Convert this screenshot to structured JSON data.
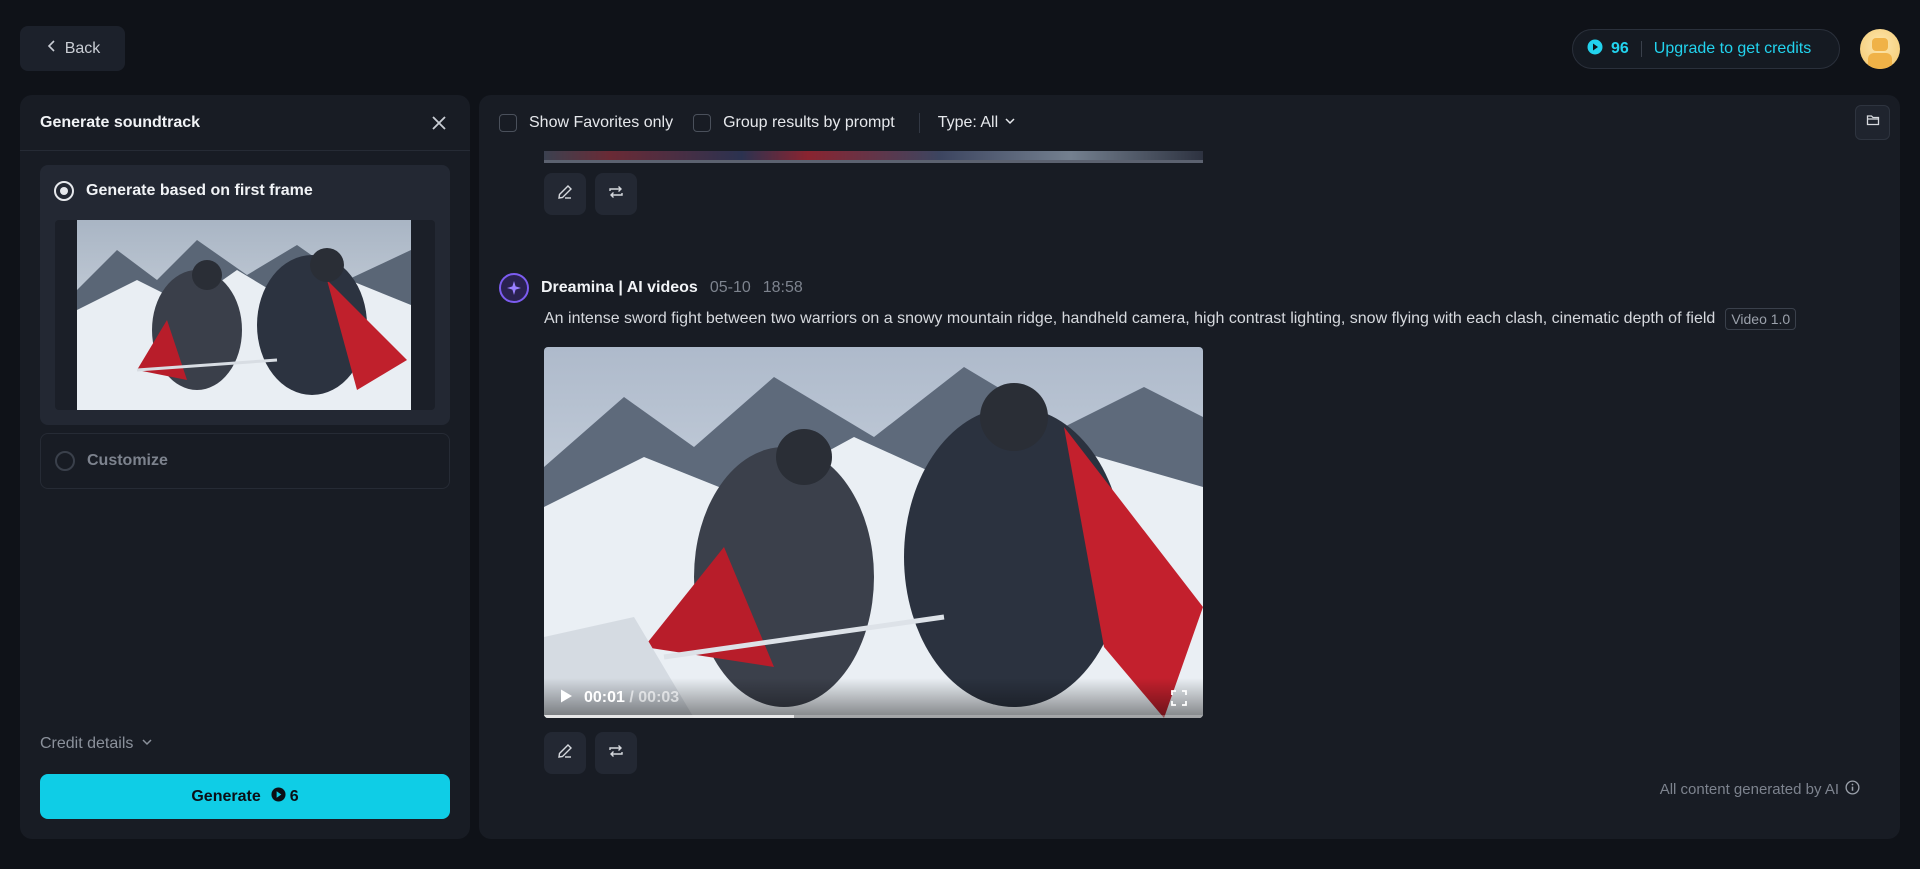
{
  "header": {
    "back_label": "Back",
    "credits": "96",
    "upgrade_label": "Upgrade to get credits"
  },
  "soundtrack_panel": {
    "title": "Generate soundtrack",
    "options": [
      {
        "label": "Generate based on first frame",
        "selected": true
      },
      {
        "label": "Customize",
        "selected": false
      }
    ],
    "credit_details_label": "Credit details",
    "generate_label": "Generate",
    "generate_cost": "6"
  },
  "filters": {
    "favorites_label": "Show Favorites only",
    "favorites_checked": false,
    "group_label": "Group results by prompt",
    "group_checked": false,
    "type_label": "Type: All"
  },
  "entry": {
    "author": "Dreamina | AI videos",
    "date": "05-10",
    "time": "18:58",
    "prompt": "An intense sword fight between two warriors on a snowy mountain ridge, handheld camera, high contrast lighting, snow flying with each clash, cinematic depth of field",
    "model": "Video 1.0",
    "player": {
      "current_time": "00:01",
      "duration": "/ 00:03",
      "progress_fraction": 0.38
    }
  },
  "footer_note": "All content generated by AI",
  "colors": {
    "accent": "#0fcde6",
    "brand_purple": "#7c5cf0"
  },
  "icons": [
    "chevron-left-icon",
    "credit-coin-icon",
    "close-icon",
    "chevron-down-icon",
    "folder-icon",
    "edit-icon",
    "repeat-icon",
    "play-icon",
    "fullscreen-icon",
    "info-icon"
  ]
}
